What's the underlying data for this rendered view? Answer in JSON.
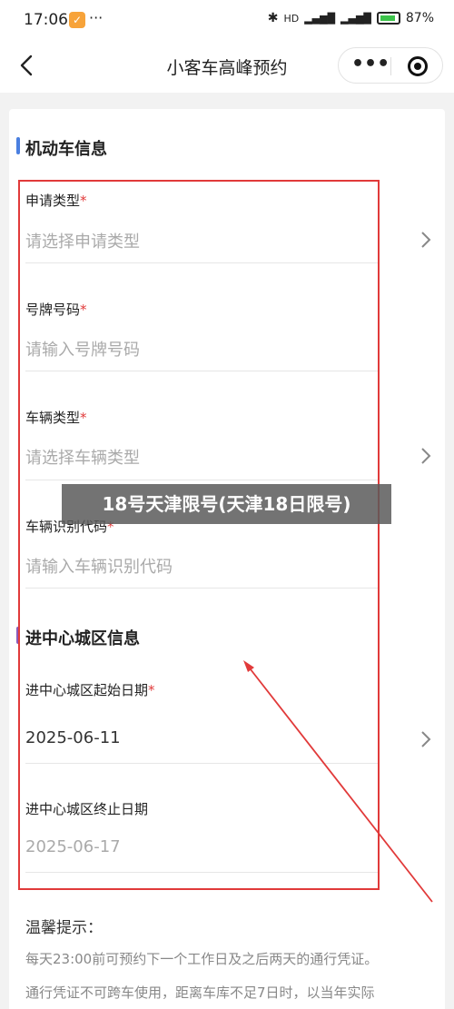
{
  "status": {
    "time": "17:06",
    "battery": "87%",
    "dots": "···"
  },
  "nav": {
    "title": "小客车高峰预约",
    "more": "•••"
  },
  "section1": {
    "title": "机动车信息",
    "color": "#4a7fe0"
  },
  "fields1": [
    {
      "label": "申请类型",
      "required": "*",
      "placeholder": "请选择申请类型"
    },
    {
      "label": "号牌号码",
      "required": "*",
      "placeholder": "请输入号牌号码"
    },
    {
      "label": "车辆类型",
      "required": "*",
      "placeholder": "请选择车辆类型"
    },
    {
      "label": "车辆识别代码",
      "required": "*",
      "placeholder": "请输入车辆识别代码"
    }
  ],
  "section2": {
    "title": "进中心城区信息",
    "color": "#8a5bb8"
  },
  "fields2": [
    {
      "label": "进中心城区起始日期",
      "required": "*",
      "value": "2025-06-11"
    },
    {
      "label": "进中心城区终止日期",
      "value": "2025-06-17"
    }
  ],
  "overlay": {
    "text": "18号天津限号(天津18日限号)"
  },
  "tips": {
    "title": "温馨提示：",
    "line1": "每天23:00前可预约下一个工作日及之后两天的通行凭证。",
    "line2": "通行凭证不可跨车使用，距离车库不足7日时，以当年实际"
  },
  "colors": {
    "annotation": "#e13a3a"
  }
}
